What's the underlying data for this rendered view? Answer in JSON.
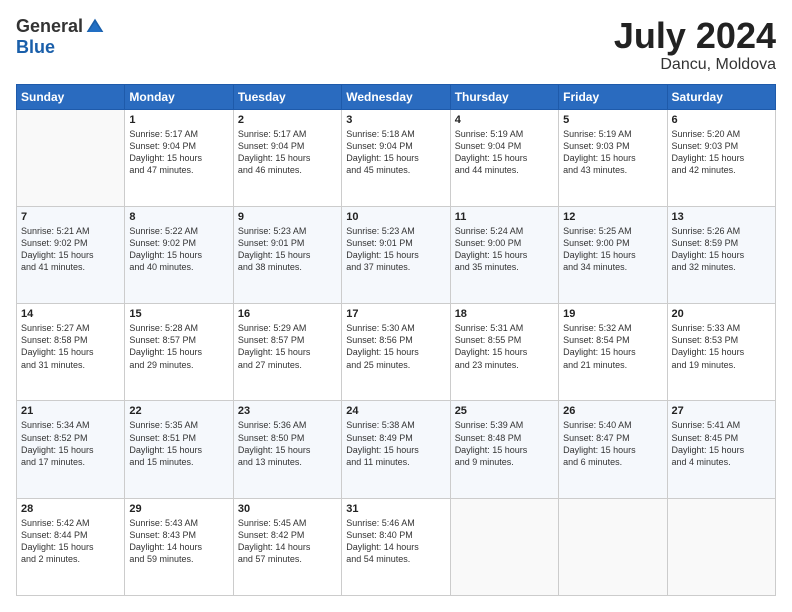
{
  "logo": {
    "general": "General",
    "blue": "Blue"
  },
  "title": "July 2024",
  "location": "Dancu, Moldova",
  "days_of_week": [
    "Sunday",
    "Monday",
    "Tuesday",
    "Wednesday",
    "Thursday",
    "Friday",
    "Saturday"
  ],
  "weeks": [
    [
      {
        "day": "",
        "info": ""
      },
      {
        "day": "1",
        "info": "Sunrise: 5:17 AM\nSunset: 9:04 PM\nDaylight: 15 hours\nand 47 minutes."
      },
      {
        "day": "2",
        "info": "Sunrise: 5:17 AM\nSunset: 9:04 PM\nDaylight: 15 hours\nand 46 minutes."
      },
      {
        "day": "3",
        "info": "Sunrise: 5:18 AM\nSunset: 9:04 PM\nDaylight: 15 hours\nand 45 minutes."
      },
      {
        "day": "4",
        "info": "Sunrise: 5:19 AM\nSunset: 9:04 PM\nDaylight: 15 hours\nand 44 minutes."
      },
      {
        "day": "5",
        "info": "Sunrise: 5:19 AM\nSunset: 9:03 PM\nDaylight: 15 hours\nand 43 minutes."
      },
      {
        "day": "6",
        "info": "Sunrise: 5:20 AM\nSunset: 9:03 PM\nDaylight: 15 hours\nand 42 minutes."
      }
    ],
    [
      {
        "day": "7",
        "info": "Sunrise: 5:21 AM\nSunset: 9:02 PM\nDaylight: 15 hours\nand 41 minutes."
      },
      {
        "day": "8",
        "info": "Sunrise: 5:22 AM\nSunset: 9:02 PM\nDaylight: 15 hours\nand 40 minutes."
      },
      {
        "day": "9",
        "info": "Sunrise: 5:23 AM\nSunset: 9:01 PM\nDaylight: 15 hours\nand 38 minutes."
      },
      {
        "day": "10",
        "info": "Sunrise: 5:23 AM\nSunset: 9:01 PM\nDaylight: 15 hours\nand 37 minutes."
      },
      {
        "day": "11",
        "info": "Sunrise: 5:24 AM\nSunset: 9:00 PM\nDaylight: 15 hours\nand 35 minutes."
      },
      {
        "day": "12",
        "info": "Sunrise: 5:25 AM\nSunset: 9:00 PM\nDaylight: 15 hours\nand 34 minutes."
      },
      {
        "day": "13",
        "info": "Sunrise: 5:26 AM\nSunset: 8:59 PM\nDaylight: 15 hours\nand 32 minutes."
      }
    ],
    [
      {
        "day": "14",
        "info": "Sunrise: 5:27 AM\nSunset: 8:58 PM\nDaylight: 15 hours\nand 31 minutes."
      },
      {
        "day": "15",
        "info": "Sunrise: 5:28 AM\nSunset: 8:57 PM\nDaylight: 15 hours\nand 29 minutes."
      },
      {
        "day": "16",
        "info": "Sunrise: 5:29 AM\nSunset: 8:57 PM\nDaylight: 15 hours\nand 27 minutes."
      },
      {
        "day": "17",
        "info": "Sunrise: 5:30 AM\nSunset: 8:56 PM\nDaylight: 15 hours\nand 25 minutes."
      },
      {
        "day": "18",
        "info": "Sunrise: 5:31 AM\nSunset: 8:55 PM\nDaylight: 15 hours\nand 23 minutes."
      },
      {
        "day": "19",
        "info": "Sunrise: 5:32 AM\nSunset: 8:54 PM\nDaylight: 15 hours\nand 21 minutes."
      },
      {
        "day": "20",
        "info": "Sunrise: 5:33 AM\nSunset: 8:53 PM\nDaylight: 15 hours\nand 19 minutes."
      }
    ],
    [
      {
        "day": "21",
        "info": "Sunrise: 5:34 AM\nSunset: 8:52 PM\nDaylight: 15 hours\nand 17 minutes."
      },
      {
        "day": "22",
        "info": "Sunrise: 5:35 AM\nSunset: 8:51 PM\nDaylight: 15 hours\nand 15 minutes."
      },
      {
        "day": "23",
        "info": "Sunrise: 5:36 AM\nSunset: 8:50 PM\nDaylight: 15 hours\nand 13 minutes."
      },
      {
        "day": "24",
        "info": "Sunrise: 5:38 AM\nSunset: 8:49 PM\nDaylight: 15 hours\nand 11 minutes."
      },
      {
        "day": "25",
        "info": "Sunrise: 5:39 AM\nSunset: 8:48 PM\nDaylight: 15 hours\nand 9 minutes."
      },
      {
        "day": "26",
        "info": "Sunrise: 5:40 AM\nSunset: 8:47 PM\nDaylight: 15 hours\nand 6 minutes."
      },
      {
        "day": "27",
        "info": "Sunrise: 5:41 AM\nSunset: 8:45 PM\nDaylight: 15 hours\nand 4 minutes."
      }
    ],
    [
      {
        "day": "28",
        "info": "Sunrise: 5:42 AM\nSunset: 8:44 PM\nDaylight: 15 hours\nand 2 minutes."
      },
      {
        "day": "29",
        "info": "Sunrise: 5:43 AM\nSunset: 8:43 PM\nDaylight: 14 hours\nand 59 minutes."
      },
      {
        "day": "30",
        "info": "Sunrise: 5:45 AM\nSunset: 8:42 PM\nDaylight: 14 hours\nand 57 minutes."
      },
      {
        "day": "31",
        "info": "Sunrise: 5:46 AM\nSunset: 8:40 PM\nDaylight: 14 hours\nand 54 minutes."
      },
      {
        "day": "",
        "info": ""
      },
      {
        "day": "",
        "info": ""
      },
      {
        "day": "",
        "info": ""
      }
    ]
  ]
}
